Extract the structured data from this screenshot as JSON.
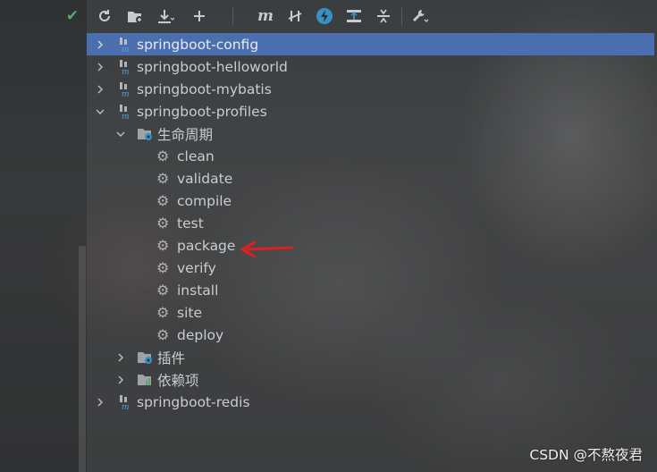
{
  "toolbar": {
    "icons": [
      "check-icon",
      "reload-icon",
      "add-folder-icon",
      "download-icon",
      "plus-icon",
      "maven-goal-icon",
      "toggle-offline-icon",
      "lightning-icon",
      "show-dependencies-icon",
      "collapse-icon",
      "wrench-icon"
    ]
  },
  "tree": {
    "projects": [
      {
        "name": "springboot-config",
        "selected": true,
        "expanded": false
      },
      {
        "name": "springboot-helloworld",
        "expanded": false
      },
      {
        "name": "springboot-mybatis",
        "expanded": false
      },
      {
        "name": "springboot-profiles",
        "expanded": true
      },
      {
        "name": "springboot-redis",
        "expanded": false
      }
    ],
    "lifecycle": {
      "label": "生命周期",
      "goals": [
        "clean",
        "validate",
        "compile",
        "test",
        "package",
        "verify",
        "install",
        "site",
        "deploy"
      ]
    },
    "plugins_label": "插件",
    "dependencies_label": "依赖项"
  },
  "annotation": {
    "color": "#e02020",
    "points_to": "package"
  },
  "watermark": "CSDN @不熬夜君"
}
